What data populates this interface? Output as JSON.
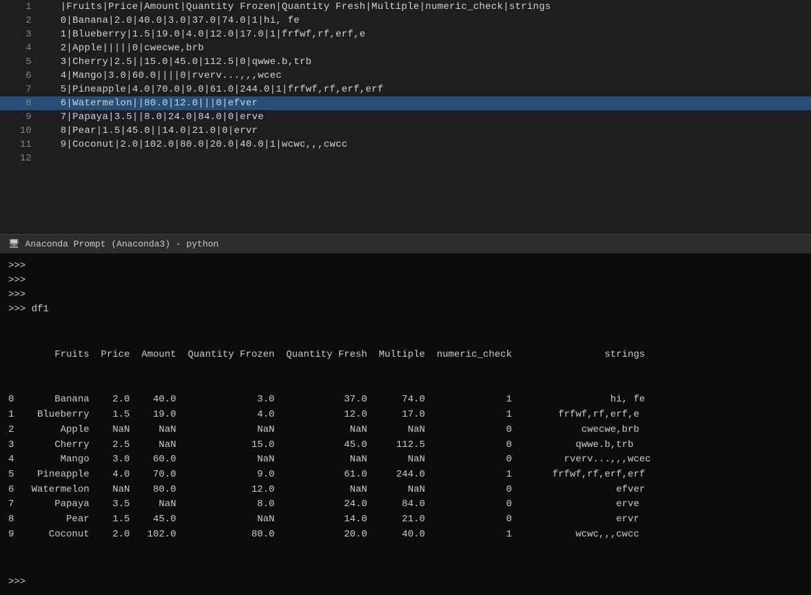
{
  "editor": {
    "lines": [
      {
        "num": "1",
        "content": "   |Fruits|Price|Amount|Quantity Frozen|Quantity Fresh|Multiple|numeric_check|strings"
      },
      {
        "num": "2",
        "content": "   0|Banana|2.0|40.0|3.0|37.0|74.0|1|hi, fe"
      },
      {
        "num": "3",
        "content": "   1|Blueberry|1.5|19.0|4.0|12.0|17.0|1|frfwf,rf,erf,e"
      },
      {
        "num": "4",
        "content": "   2|Apple|||||0|cwecwe,brb"
      },
      {
        "num": "5",
        "content": "   3|Cherry|2.5||15.0|45.0|112.5|0|qwwe.b,trb"
      },
      {
        "num": "6",
        "content": "   4|Mango|3.0|60.0||||0|rverv...,,,wcec"
      },
      {
        "num": "7",
        "content": "   5|Pineapple|4.0|70.0|9.0|61.0|244.0|1|frfwf,rf,erf,erf"
      },
      {
        "num": "8",
        "content": "   6|Watermelon||80.0|12.0|||0|efver",
        "highlight": true
      },
      {
        "num": "9",
        "content": "   7|Papaya|3.5||8.0|24.0|84.0|0|erve"
      },
      {
        "num": "10",
        "content": "   8|Pear|1.5|45.0||14.0|21.0|0|ervr"
      },
      {
        "num": "11",
        "content": "   9|Coconut|2.0|102.0|80.0|20.0|40.0|1|wcwc,,,cwcc"
      },
      {
        "num": "12",
        "content": ""
      }
    ]
  },
  "titlebar": {
    "label": "Anaconda Prompt (Anaconda3) - python",
    "icon": "🖥"
  },
  "terminal": {
    "prompts": [
      ">>>",
      ">>>",
      ">>>",
      ">>> df1"
    ],
    "df_header": "        Fruits  Price  Amount  Quantity Frozen  Quantity Fresh  Multiple  numeric_check                strings",
    "df_rows": [
      "0       Banana    2.0    40.0              3.0            37.0      74.0              1                 hi, fe",
      "1    Blueberry    1.5    19.0              4.0            12.0      17.0              1        frfwf,rf,erf,e",
      "2        Apple    NaN     NaN              NaN             NaN       NaN              0            cwecwe,brb",
      "3       Cherry    2.5     NaN             15.0            45.0     112.5              0           qwwe.b,trb",
      "4        Mango    3.0    60.0              NaN             NaN       NaN              0         rverv...,,,wcec",
      "5    Pineapple    4.0    70.0              9.0            61.0     244.0              1       frfwf,rf,erf,erf",
      "6   Watermelon    NaN    80.0             12.0             NaN       NaN              0                  efver",
      "7       Papaya    3.5     NaN              8.0            24.0      84.0              0                  erve",
      "8         Pear    1.5    45.0              NaN            14.0      21.0              0                  ervr",
      "9      Coconut    2.0   102.0             80.0            20.0      40.0              1           wcwc,,,cwcc"
    ],
    "bottom_prompt": ">>>"
  }
}
